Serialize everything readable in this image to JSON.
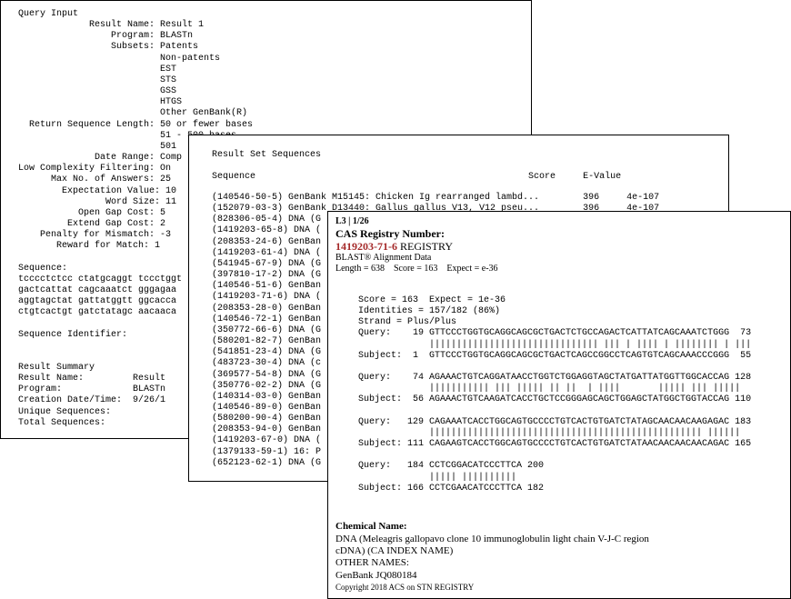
{
  "panel1": {
    "lines": [
      "Query Input",
      "             Result Name: Result 1",
      "                 Program: BLASTn",
      "                 Subsets: Patents",
      "                          Non-patents",
      "                          EST",
      "                          STS",
      "                          GSS",
      "                          HTGS",
      "                          Other GenBank(R)",
      "  Return Sequence Length: 50 or fewer bases",
      "                          51 - 500 bases",
      "                          501",
      "              Date Range: Comp",
      "Low Complexity Filtering: On",
      "      Max No. of Answers: 25",
      "        Expectation Value: 10",
      "                Word Size: 11",
      "           Open Gap Cost: 5",
      "         Extend Gap Cost: 2",
      "    Penalty for Mismatch: -3",
      "       Reward for Match: 1",
      "",
      "Sequence:",
      "tcccctctcc ctatgcaggt tccctggt",
      "gactcattat cagcaaatct gggagaa",
      "aggtagctat gattatggtt ggcacca",
      "ctgtcactgt gatctatagc aacaaca",
      "",
      "Sequence Identifier:",
      "",
      "",
      "Result Summary",
      "Result Name:         Result",
      "Program:             BLASTn",
      "Creation Date/Time:  9/26/1",
      "Unique Sequences:",
      "Total Sequences:"
    ]
  },
  "panel2": {
    "title": "Result Set Sequences",
    "header": "Sequence                                                  Score     E-Value",
    "rows": [
      "(140546-50-5) GenBank M15145: Chicken Ig rearranged lambd...        396     4e-107",
      "(152079-03-3) GenBank D13440: Gallus gallus V13, V12 pseu...        396     4e-107",
      "(828306-05-4) DNA (G",
      "(1419203-65-8) DNA (",
      "(208353-24-6) GenBan",
      "(1419203-61-4) DNA (",
      "(541945-67-9) DNA (G",
      "(397810-17-2) DNA (G",
      "(140546-51-6) GenBan",
      "(1419203-71-6) DNA (",
      "(208353-28-0) GenBan",
      "(140546-72-1) GenBan",
      "(350772-66-6) DNA (G",
      "(580201-82-7) GenBan",
      "(541851-23-4) DNA (G",
      "(483723-30-4) DNA (c",
      "(369577-54-8) DNA (G",
      "(350776-02-2) DNA (G",
      "(140314-03-0) GenBan",
      "(140546-89-0) GenBan",
      "(580200-90-4) GenBan",
      "(208353-94-0) GenBan",
      "(1419203-67-0) DNA (",
      "(1379133-59-1) 16: P",
      "(652123-62-1) DNA (G"
    ]
  },
  "panel3": {
    "locator": "L3 | 1/26",
    "cas_label": "CAS Registry Number:",
    "registry_number": "1419203-71-6",
    "registry_word": " REGISTRY",
    "blast_label": "BLAST® Alignment Data",
    "summary": "Length = 638    Score = 163    Expect = e-36",
    "alignment": [
      "Score = 163  Expect = 1e-36",
      "Identities = 157/182 (86%)",
      "Strand = Plus/Plus",
      "Query:    19 GTTCCCTGGTGCAGGCAGCGCTGACTCTGCCAGACTCATTATCAGCAAATCTGGG  73",
      "             ||||||||||||||||||||||||||||||| ||| | |||| | |||||||| | |||",
      "Subject:  1  GTTCCCTGGTGCAGGCAGCGCTGACTCAGCCGGCCTCAGTGTCAGCAAACCCGGG  55",
      "",
      "Query:    74 AGAAACTGTCAGGATAACCTGGTCTGGAGGTAGCTATGATTATGGTTGGCACCAG 128",
      "             ||||||||||| ||| ||||| || ||  | ||||       ||||| ||| |||||",
      "Subject:  56 AGAAACTGTCAAGATCACCTGCTCCGGGAGCAGCTGGAGCTATGGCTGGTACCAG 110",
      "",
      "Query:   129 CAGAAATCACCTGGCAGTGCCCCTGTCACTGTGATCTATAGCAACAACAAGAGAC 183",
      "             |||||||||||||||||||||||||||||||||||||||||||||||||| ||||||",
      "Subject: 111 CAGAAGTCACCTGGCAGTGCCCCTGTCACTGTGATCTATAACAACAACAACAGAC 165",
      "",
      "Query:   184 CCTCGGACATCCCTTCA 200",
      "             ||||| ||||||||||",
      "Subject: 166 CCTCGAACATCCCTTCA 182"
    ],
    "chem_label": "Chemical Name:",
    "chem_name_1": "DNA (Meleagris gallopavo clone 10 immunoglobulin light chain V-J-C region",
    "chem_name_2": "cDNA) (CA INDEX NAME)",
    "other_names_label": "OTHER NAMES:",
    "other_name": "GenBank JQ080184",
    "copyright": "Copyright 2018 ACS on STN REGISTRY"
  }
}
